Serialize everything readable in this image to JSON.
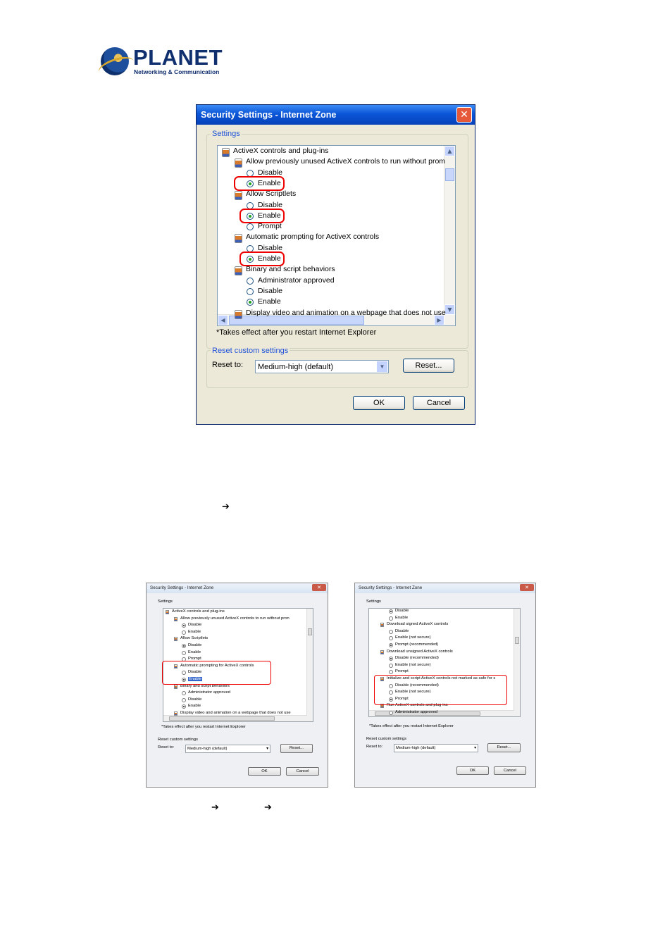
{
  "logo": {
    "word": "PLANET",
    "tagline": "Networking & Communication"
  },
  "main_dialog": {
    "title": "Security Settings - Internet Zone",
    "close_glyph": "✕",
    "settings_legend": "Settings",
    "items": [
      {
        "kind": "category",
        "text": "ActiveX controls and plug-ins"
      },
      {
        "kind": "setting",
        "text": "Allow previously unused ActiveX controls to run without prom"
      },
      {
        "kind": "option",
        "text": "Disable",
        "checked": false
      },
      {
        "kind": "option",
        "text": "Enable",
        "checked": true,
        "highlighted": true
      },
      {
        "kind": "setting",
        "text": "Allow Scriptlets"
      },
      {
        "kind": "option",
        "text": "Disable",
        "checked": false
      },
      {
        "kind": "option",
        "text": "Enable",
        "checked": true,
        "highlighted": true
      },
      {
        "kind": "option",
        "text": "Prompt",
        "checked": false
      },
      {
        "kind": "setting",
        "text": "Automatic prompting for ActiveX controls"
      },
      {
        "kind": "option",
        "text": "Disable",
        "checked": false
      },
      {
        "kind": "option",
        "text": "Enable",
        "checked": true,
        "highlighted": true
      },
      {
        "kind": "setting",
        "text": "Binary and script behaviors"
      },
      {
        "kind": "option",
        "text": "Administrator approved",
        "checked": false
      },
      {
        "kind": "option",
        "text": "Disable",
        "checked": false
      },
      {
        "kind": "option",
        "text": "Enable",
        "checked": true
      },
      {
        "kind": "setting",
        "text": "Display video and animation on a webpage that does not use"
      }
    ],
    "note": "*Takes effect after you restart Internet Explorer",
    "reset_legend": "Reset custom settings",
    "reset_label": "Reset to:",
    "reset_value": "Medium-high (default)",
    "reset_button": "Reset...",
    "ok": "OK",
    "cancel": "Cancel"
  },
  "arrow_line1": "➔",
  "arrow_line2": [
    "➔",
    "➔"
  ],
  "left_dialog": {
    "title": "Security Settings - Internet Zone",
    "settings_legend": "Settings",
    "items": [
      {
        "kind": "category",
        "text": "ActiveX controls and plug-ins"
      },
      {
        "kind": "setting",
        "text": "Allow previously unused ActiveX controls to run without pron"
      },
      {
        "kind": "option",
        "text": "Disable",
        "checked": true
      },
      {
        "kind": "option",
        "text": "Enable",
        "checked": false
      },
      {
        "kind": "setting",
        "text": "Allow Scriptlets"
      },
      {
        "kind": "option",
        "text": "Disable",
        "checked": true
      },
      {
        "kind": "option",
        "text": "Enable",
        "checked": false
      },
      {
        "kind": "option",
        "text": "Prompt",
        "checked": false
      },
      {
        "kind": "setting",
        "text": "Automatic prompting for ActiveX controls"
      },
      {
        "kind": "option",
        "text": "Disable",
        "checked": false
      },
      {
        "kind": "option",
        "text": "Enable",
        "checked": true,
        "selected": true
      },
      {
        "kind": "setting",
        "text": "Binary and script behaviors"
      },
      {
        "kind": "option",
        "text": "Administrator approved",
        "checked": false
      },
      {
        "kind": "option",
        "text": "Disable",
        "checked": false
      },
      {
        "kind": "option",
        "text": "Enable",
        "checked": true
      },
      {
        "kind": "setting",
        "text": "Display video and animation on a webpage that does not use"
      }
    ],
    "note": "*Takes effect after you restart Internet Explorer",
    "reset_legend": "Reset custom settings",
    "reset_label": "Reset to:",
    "reset_value": "Medium-high (default)",
    "reset_button": "Reset...",
    "ok": "OK",
    "cancel": "Cancel"
  },
  "right_dialog": {
    "title": "Security Settings - Internet Zone",
    "settings_legend": "Settings",
    "items": [
      {
        "kind": "option",
        "text": "Disable",
        "checked": true
      },
      {
        "kind": "option",
        "text": "Enable",
        "checked": false
      },
      {
        "kind": "setting",
        "text": "Download signed ActiveX controls"
      },
      {
        "kind": "option",
        "text": "Disable",
        "checked": false
      },
      {
        "kind": "option",
        "text": "Enable (not secure)",
        "checked": false
      },
      {
        "kind": "option",
        "text": "Prompt (recommended)",
        "checked": true
      },
      {
        "kind": "setting",
        "text": "Download unsigned ActiveX controls"
      },
      {
        "kind": "option",
        "text": "Disable (recommended)",
        "checked": true
      },
      {
        "kind": "option",
        "text": "Enable (not secure)",
        "checked": false
      },
      {
        "kind": "option",
        "text": "Prompt",
        "checked": false
      },
      {
        "kind": "setting",
        "text": "Initialize and script ActiveX controls not marked as safe for s"
      },
      {
        "kind": "option",
        "text": "Disable (recommended)",
        "checked": false
      },
      {
        "kind": "option",
        "text": "Enable (not secure)",
        "checked": false
      },
      {
        "kind": "option",
        "text": "Prompt",
        "checked": true
      },
      {
        "kind": "setting",
        "text": "Run ActiveX controls and plug-ins"
      },
      {
        "kind": "option",
        "text": "Administrator approved",
        "checked": false
      }
    ],
    "note": "*Takes effect after you restart Internet Explorer",
    "reset_legend": "Reset custom settings",
    "reset_label": "Reset to:",
    "reset_value": "Medium-high (default)",
    "reset_button": "Reset...",
    "ok": "OK",
    "cancel": "Cancel"
  }
}
